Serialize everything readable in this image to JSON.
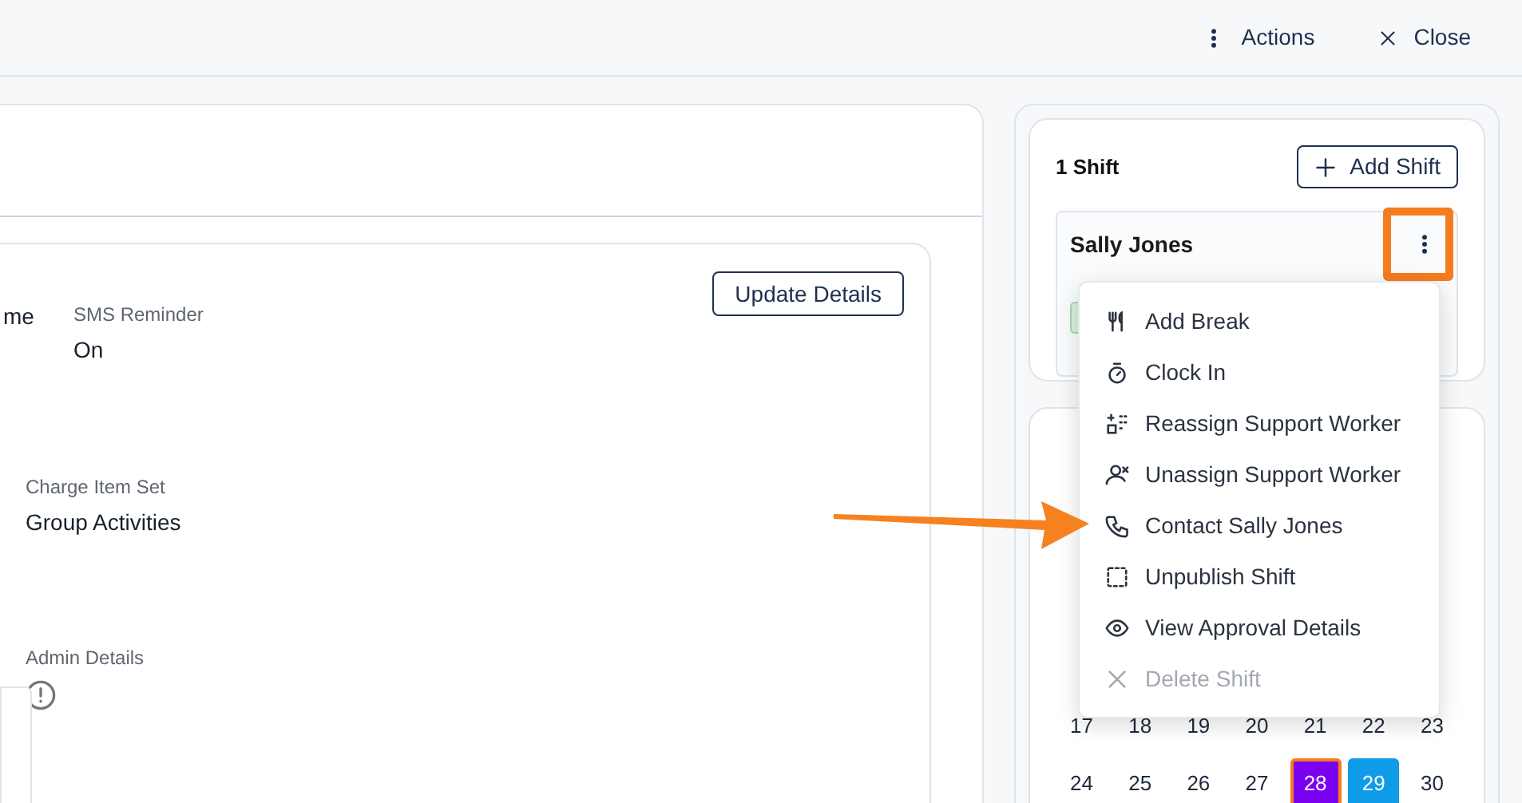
{
  "header": {
    "actions": [
      {
        "kind": "more",
        "label": "Actions"
      },
      {
        "kind": "close",
        "label": "Close"
      }
    ]
  },
  "details": {
    "button": "Update Details",
    "fields": [
      {
        "kind": "value",
        "value": "me"
      },
      {
        "kind": "value",
        "label": "SMS Reminder",
        "value": "On"
      },
      {
        "kind": "value",
        "label": "Charge Item Set",
        "value": "Group Activities"
      },
      {
        "kind": "info",
        "label": "Admin Details"
      }
    ]
  },
  "shifts": {
    "count": "1 Shift",
    "add_button": "Add Shift",
    "shift": {
      "name": "Sally Jones",
      "menu_open": true
    }
  },
  "menu": [
    {
      "kind": "fork",
      "label": "Add Break",
      "disabled": false
    },
    {
      "kind": "timer",
      "label": "Clock In",
      "disabled": false
    },
    {
      "kind": "reassign",
      "label": "Reassign Support Worker",
      "disabled": false
    },
    {
      "kind": "unassign",
      "label": "Unassign Support Worker",
      "disabled": false
    },
    {
      "kind": "phone",
      "label": "Contact Sally Jones",
      "disabled": false
    },
    {
      "kind": "dashed",
      "label": "Unpublish Shift",
      "disabled": false
    },
    {
      "kind": "eye",
      "label": "View Approval Details",
      "disabled": false
    },
    {
      "kind": "x",
      "label": "Delete Shift",
      "disabled": true
    }
  ],
  "calendar": {
    "weeks": [
      [
        {
          "day": "17",
          "selected": false
        },
        {
          "day": "18",
          "selected": false
        },
        {
          "day": "19",
          "selected": false
        },
        {
          "day": "20",
          "selected": false
        },
        {
          "day": "21",
          "selected": false
        },
        {
          "day": "22",
          "selected": false
        },
        {
          "day": "23",
          "selected": false
        }
      ],
      [
        {
          "day": "24",
          "selected": false
        },
        {
          "day": "25",
          "selected": false
        },
        {
          "day": "26",
          "selected": false
        },
        {
          "day": "27",
          "selected": false
        },
        {
          "day": "28",
          "selected": true,
          "color": "#7c00f0"
        },
        {
          "day": "29",
          "selected": false,
          "color": "#0f9be8"
        },
        {
          "day": "30",
          "selected": false
        }
      ]
    ]
  }
}
